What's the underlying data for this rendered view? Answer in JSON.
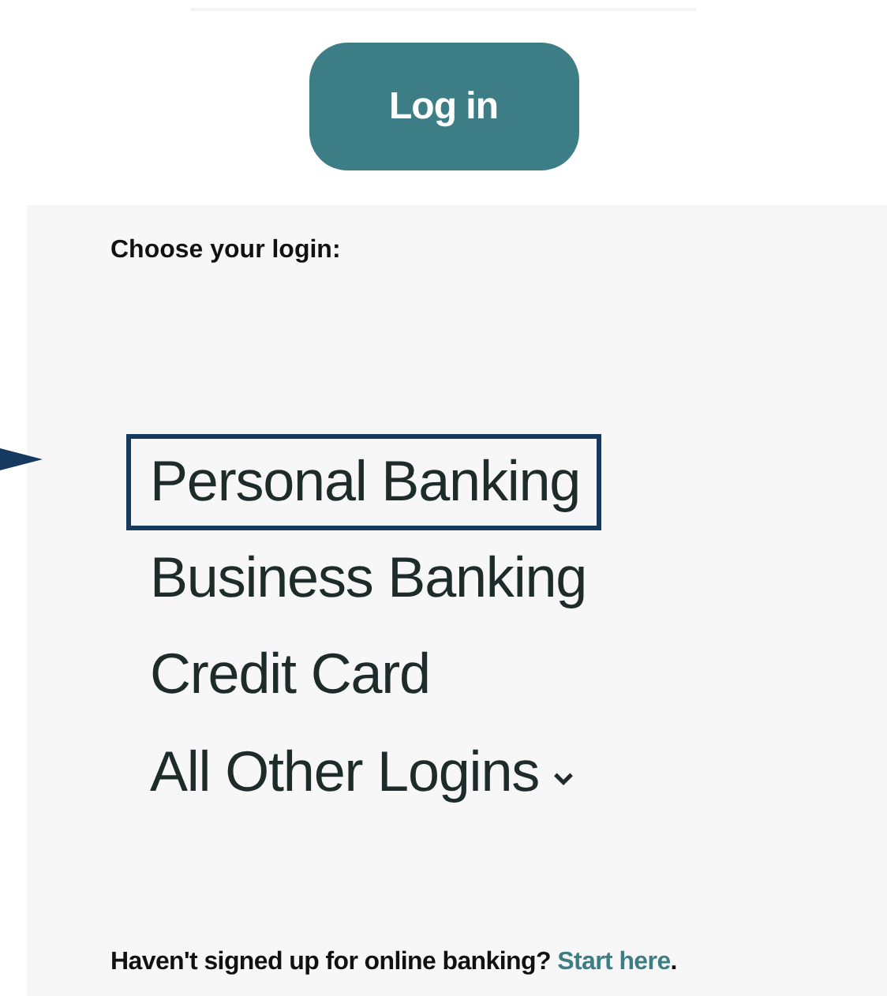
{
  "login_button": {
    "label": "Log in"
  },
  "prompt": "Choose your login:",
  "login_options": [
    {
      "label": "Personal Banking",
      "kind": "link",
      "selected": true
    },
    {
      "label": "Business Banking",
      "kind": "link",
      "selected": false
    },
    {
      "label": "Credit Card",
      "kind": "link",
      "selected": false
    },
    {
      "label": "All Other Logins",
      "kind": "dropdown",
      "selected": false
    }
  ],
  "footer": {
    "text": "Haven't signed up for online banking?",
    "link": "Start here",
    "end": "."
  }
}
